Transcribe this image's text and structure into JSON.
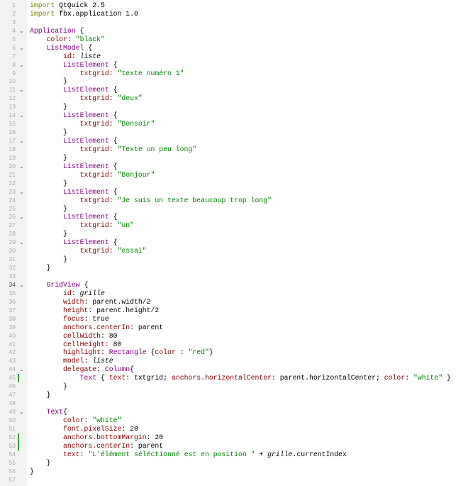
{
  "editor": {
    "current_line": 34,
    "lines": [
      {
        "n": 1,
        "tokens": [
          [
            "k",
            "import"
          ],
          [
            "n",
            " QtQuick 2.5"
          ]
        ]
      },
      {
        "n": 2,
        "tokens": [
          [
            "k",
            "import"
          ],
          [
            "n",
            " fbx.application 1.0"
          ]
        ]
      },
      {
        "n": 3,
        "tokens": []
      },
      {
        "n": 4,
        "fold": true,
        "tokens": [
          [
            "t",
            "Application"
          ],
          [
            "n",
            " {"
          ]
        ]
      },
      {
        "n": 5,
        "tokens": [
          [
            "n",
            "    "
          ],
          [
            "p",
            "color"
          ],
          [
            "n",
            ": "
          ],
          [
            "s",
            "\"black\""
          ]
        ]
      },
      {
        "n": 6,
        "fold": true,
        "tokens": [
          [
            "n",
            "    "
          ],
          [
            "t",
            "ListModel"
          ],
          [
            "n",
            " {"
          ]
        ]
      },
      {
        "n": 7,
        "tokens": [
          [
            "n",
            "        "
          ],
          [
            "p",
            "id"
          ],
          [
            "n",
            ": "
          ],
          [
            "i",
            "liste"
          ]
        ]
      },
      {
        "n": 8,
        "fold": true,
        "tokens": [
          [
            "n",
            "        "
          ],
          [
            "t",
            "ListElement"
          ],
          [
            "n",
            " {"
          ]
        ]
      },
      {
        "n": 9,
        "tokens": [
          [
            "n",
            "            "
          ],
          [
            "p",
            "txtgrid"
          ],
          [
            "n",
            ": "
          ],
          [
            "s",
            "\"texte numéro 1\""
          ]
        ]
      },
      {
        "n": 10,
        "tokens": [
          [
            "n",
            "        }"
          ]
        ]
      },
      {
        "n": 11,
        "fold": true,
        "tokens": [
          [
            "n",
            "        "
          ],
          [
            "t",
            "ListElement"
          ],
          [
            "n",
            " {"
          ]
        ]
      },
      {
        "n": 12,
        "tokens": [
          [
            "n",
            "            "
          ],
          [
            "p",
            "txtgrid"
          ],
          [
            "n",
            ": "
          ],
          [
            "s",
            "\"deux\""
          ]
        ]
      },
      {
        "n": 13,
        "tokens": [
          [
            "n",
            "        }"
          ]
        ]
      },
      {
        "n": 14,
        "fold": true,
        "tokens": [
          [
            "n",
            "        "
          ],
          [
            "t",
            "ListElement"
          ],
          [
            "n",
            " {"
          ]
        ]
      },
      {
        "n": 15,
        "tokens": [
          [
            "n",
            "            "
          ],
          [
            "p",
            "txtgrid"
          ],
          [
            "n",
            ": "
          ],
          [
            "s",
            "\"Bonsoir\""
          ]
        ]
      },
      {
        "n": 16,
        "tokens": [
          [
            "n",
            "        }"
          ]
        ]
      },
      {
        "n": 17,
        "fold": true,
        "tokens": [
          [
            "n",
            "        "
          ],
          [
            "t",
            "ListElement"
          ],
          [
            "n",
            " {"
          ]
        ]
      },
      {
        "n": 18,
        "tokens": [
          [
            "n",
            "            "
          ],
          [
            "p",
            "txtgrid"
          ],
          [
            "n",
            ": "
          ],
          [
            "s",
            "\"Texte un peu long\""
          ]
        ]
      },
      {
        "n": 19,
        "tokens": [
          [
            "n",
            "        }"
          ]
        ]
      },
      {
        "n": 20,
        "fold": true,
        "tokens": [
          [
            "n",
            "        "
          ],
          [
            "t",
            "ListElement"
          ],
          [
            "n",
            " {"
          ]
        ]
      },
      {
        "n": 21,
        "tokens": [
          [
            "n",
            "            "
          ],
          [
            "p",
            "txtgrid"
          ],
          [
            "n",
            ": "
          ],
          [
            "s",
            "\"Bonjour\""
          ]
        ]
      },
      {
        "n": 22,
        "tokens": [
          [
            "n",
            "        }"
          ]
        ]
      },
      {
        "n": 23,
        "fold": true,
        "tokens": [
          [
            "n",
            "        "
          ],
          [
            "t",
            "ListElement"
          ],
          [
            "n",
            " {"
          ]
        ]
      },
      {
        "n": 24,
        "tokens": [
          [
            "n",
            "            "
          ],
          [
            "p",
            "txtgrid"
          ],
          [
            "n",
            ": "
          ],
          [
            "s",
            "\"Je suis un texte beaucoup trop long\""
          ]
        ]
      },
      {
        "n": 25,
        "tokens": [
          [
            "n",
            "        }"
          ]
        ]
      },
      {
        "n": 26,
        "fold": true,
        "tokens": [
          [
            "n",
            "        "
          ],
          [
            "t",
            "ListElement"
          ],
          [
            "n",
            " {"
          ]
        ]
      },
      {
        "n": 27,
        "tokens": [
          [
            "n",
            "            "
          ],
          [
            "p",
            "txtgrid"
          ],
          [
            "n",
            ": "
          ],
          [
            "s",
            "\"un\""
          ]
        ]
      },
      {
        "n": 28,
        "tokens": [
          [
            "n",
            "        }"
          ]
        ]
      },
      {
        "n": 29,
        "fold": true,
        "tokens": [
          [
            "n",
            "        "
          ],
          [
            "t",
            "ListElement"
          ],
          [
            "n",
            " {"
          ]
        ]
      },
      {
        "n": 30,
        "tokens": [
          [
            "n",
            "            "
          ],
          [
            "p",
            "txtgrid"
          ],
          [
            "n",
            ": "
          ],
          [
            "s",
            "\"essai\""
          ]
        ]
      },
      {
        "n": 31,
        "tokens": [
          [
            "n",
            "        }"
          ]
        ]
      },
      {
        "n": 32,
        "tokens": [
          [
            "n",
            "    }"
          ]
        ]
      },
      {
        "n": 33,
        "tokens": []
      },
      {
        "n": 34,
        "fold": true,
        "tokens": [
          [
            "n",
            "    "
          ],
          [
            "t",
            "GridView"
          ],
          [
            "n",
            " {"
          ]
        ]
      },
      {
        "n": 35,
        "tokens": [
          [
            "n",
            "        "
          ],
          [
            "p",
            "id"
          ],
          [
            "n",
            ": "
          ],
          [
            "i",
            "grille"
          ]
        ]
      },
      {
        "n": 36,
        "tokens": [
          [
            "n",
            "        "
          ],
          [
            "p",
            "width"
          ],
          [
            "n",
            ": parent.width/2"
          ]
        ]
      },
      {
        "n": 37,
        "tokens": [
          [
            "n",
            "        "
          ],
          [
            "p",
            "height"
          ],
          [
            "n",
            ": parent.height/2"
          ]
        ]
      },
      {
        "n": 38,
        "tokens": [
          [
            "n",
            "        "
          ],
          [
            "p",
            "focus"
          ],
          [
            "n",
            ": true"
          ]
        ]
      },
      {
        "n": 39,
        "tokens": [
          [
            "n",
            "        "
          ],
          [
            "p",
            "anchors.centerIn"
          ],
          [
            "n",
            ": parent"
          ]
        ]
      },
      {
        "n": 40,
        "tokens": [
          [
            "n",
            "        "
          ],
          [
            "p",
            "cellWidth"
          ],
          [
            "n",
            ": 80"
          ]
        ]
      },
      {
        "n": 41,
        "tokens": [
          [
            "n",
            "        "
          ],
          [
            "p",
            "cellHeight"
          ],
          [
            "n",
            ": 80"
          ]
        ]
      },
      {
        "n": 42,
        "tokens": [
          [
            "n",
            "        "
          ],
          [
            "p",
            "highlight"
          ],
          [
            "n",
            ": "
          ],
          [
            "t",
            "Rectangle"
          ],
          [
            "n",
            " {"
          ],
          [
            "p",
            "color"
          ],
          [
            "n",
            " : "
          ],
          [
            "s",
            "\"red\""
          ],
          [
            "n",
            "}"
          ]
        ]
      },
      {
        "n": 43,
        "tokens": [
          [
            "n",
            "        "
          ],
          [
            "p",
            "model"
          ],
          [
            "n",
            ": "
          ],
          [
            "i",
            "liste"
          ]
        ]
      },
      {
        "n": 44,
        "fold": true,
        "tokens": [
          [
            "n",
            "        "
          ],
          [
            "p",
            "delegate"
          ],
          [
            "n",
            ": "
          ],
          [
            "t",
            "Column"
          ],
          [
            "n",
            "{"
          ]
        ]
      },
      {
        "n": 45,
        "mark": true,
        "tokens": [
          [
            "n",
            "            "
          ],
          [
            "t",
            "Text"
          ],
          [
            "n",
            " { "
          ],
          [
            "p",
            "text"
          ],
          [
            "n",
            ": txtgrid; "
          ],
          [
            "p",
            "anchors.horizontalCenter"
          ],
          [
            "n",
            ": parent.horizontalCenter; "
          ],
          [
            "p",
            "color"
          ],
          [
            "n",
            ": "
          ],
          [
            "s",
            "\"white\""
          ],
          [
            "n",
            " }"
          ]
        ]
      },
      {
        "n": 46,
        "tokens": [
          [
            "n",
            "        }"
          ]
        ]
      },
      {
        "n": 47,
        "tokens": [
          [
            "n",
            "    }"
          ]
        ]
      },
      {
        "n": 48,
        "tokens": []
      },
      {
        "n": 49,
        "fold": true,
        "tokens": [
          [
            "n",
            "    "
          ],
          [
            "t",
            "Text"
          ],
          [
            "n",
            "{"
          ]
        ]
      },
      {
        "n": 50,
        "tokens": [
          [
            "n",
            "        "
          ],
          [
            "p",
            "color"
          ],
          [
            "n",
            ": "
          ],
          [
            "s",
            "\"white\""
          ]
        ]
      },
      {
        "n": 51,
        "tokens": [
          [
            "n",
            "        "
          ],
          [
            "p",
            "font.pixelSize"
          ],
          [
            "n",
            ": 20"
          ]
        ]
      },
      {
        "n": 52,
        "mark": true,
        "tokens": [
          [
            "n",
            "        "
          ],
          [
            "p",
            "anchors.bottomMargin"
          ],
          [
            "n",
            ": 20"
          ]
        ]
      },
      {
        "n": 53,
        "mark": true,
        "tokens": [
          [
            "n",
            "        "
          ],
          [
            "p",
            "anchors.centerIn"
          ],
          [
            "n",
            ": parent"
          ]
        ]
      },
      {
        "n": 54,
        "tokens": [
          [
            "n",
            "        "
          ],
          [
            "p",
            "text"
          ],
          [
            "n",
            ": "
          ],
          [
            "s",
            "\"L'élément séléctionné est en position \""
          ],
          [
            "n",
            " + "
          ],
          [
            "i",
            "grille"
          ],
          [
            "n",
            ".currentIndex"
          ]
        ]
      },
      {
        "n": 55,
        "tokens": [
          [
            "n",
            "    }"
          ]
        ]
      },
      {
        "n": 56,
        "tokens": [
          [
            "n",
            "}"
          ]
        ]
      },
      {
        "n": 57,
        "tokens": []
      }
    ]
  }
}
